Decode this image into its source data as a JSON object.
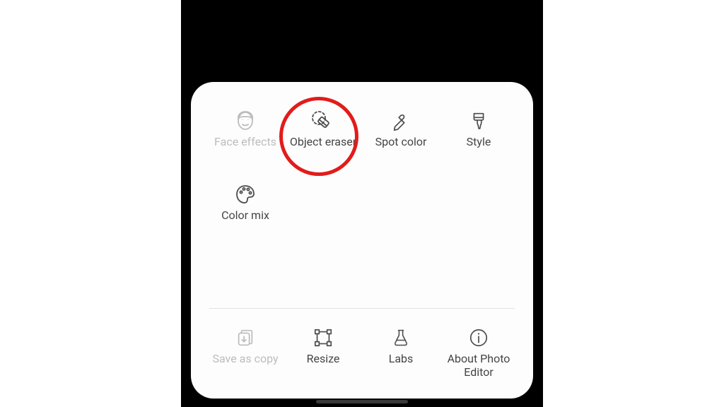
{
  "panel": {
    "row1": [
      {
        "label": "Face effects",
        "name": "face-effects",
        "icon": "face-icon",
        "disabled": true
      },
      {
        "label": "Object eraser",
        "name": "object-eraser",
        "icon": "eraser-icon",
        "disabled": false
      },
      {
        "label": "Spot color",
        "name": "spot-color",
        "icon": "dropper-icon",
        "disabled": false
      },
      {
        "label": "Style",
        "name": "style",
        "icon": "brush-icon",
        "disabled": false
      }
    ],
    "row2": [
      {
        "label": "Color mix",
        "name": "color-mix",
        "icon": "palette-icon",
        "disabled": false
      }
    ],
    "row3": [
      {
        "label": "Save as copy",
        "name": "save-as-copy",
        "icon": "copy-down-icon",
        "disabled": true
      },
      {
        "label": "Resize",
        "name": "resize",
        "icon": "resize-icon",
        "disabled": false
      },
      {
        "label": "Labs",
        "name": "labs",
        "icon": "flask-icon",
        "disabled": false
      },
      {
        "label": "About Photo Editor",
        "name": "about-photo-editor",
        "icon": "info-icon",
        "disabled": false
      }
    ]
  },
  "highlight_target": "object-eraser",
  "colors": {
    "highlight": "#e21b1b",
    "sheet_bg": "#fdfdfd",
    "phone_bg": "#000000"
  }
}
